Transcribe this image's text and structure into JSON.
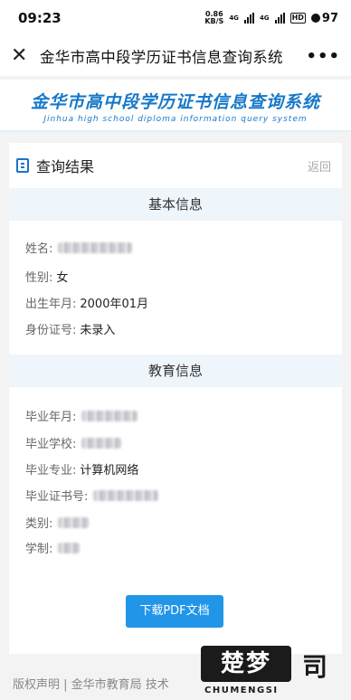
{
  "status_bar": {
    "time": "09:23",
    "net_speed_value": "0.86",
    "net_speed_unit": "KB/S",
    "network_1": "4G",
    "network_2": "4G",
    "hd": "HD",
    "battery": "97"
  },
  "nav": {
    "close_icon": "close-icon",
    "title": "金华市高中段学历证书信息查询系统",
    "more_label": "•••"
  },
  "banner": {
    "title_cn": "金华市高中段学历证书信息查询系统",
    "title_en": "Jinhua high school diploma information query system"
  },
  "card": {
    "title": "查询结果",
    "back_label": "返回",
    "basic": {
      "heading": "基本信息",
      "name_label": "姓名:",
      "gender_label": "性别:",
      "gender_value": "女",
      "birth_label": "出生年月:",
      "birth_value": "2000年01月",
      "id_label": "身份证号:",
      "id_value": "未录入"
    },
    "education": {
      "heading": "教育信息",
      "grad_date_label": "毕业年月:",
      "school_label": "毕业学校:",
      "major_label": "毕业专业:",
      "major_value": "计算机网络",
      "cert_label": "毕业证书号:",
      "category_label": "类别:",
      "duration_label": "学制:"
    },
    "download_label": "下载PDF文档"
  },
  "footer": {
    "text": "版权声明 | 金华市教育局   技术"
  },
  "watermark": {
    "main": "楚梦",
    "side": "司",
    "en": "CHUMENGSI"
  },
  "colors": {
    "accent": "#2196e8",
    "banner_blue": "#1778c9",
    "section_bg": "#eef5fb"
  }
}
